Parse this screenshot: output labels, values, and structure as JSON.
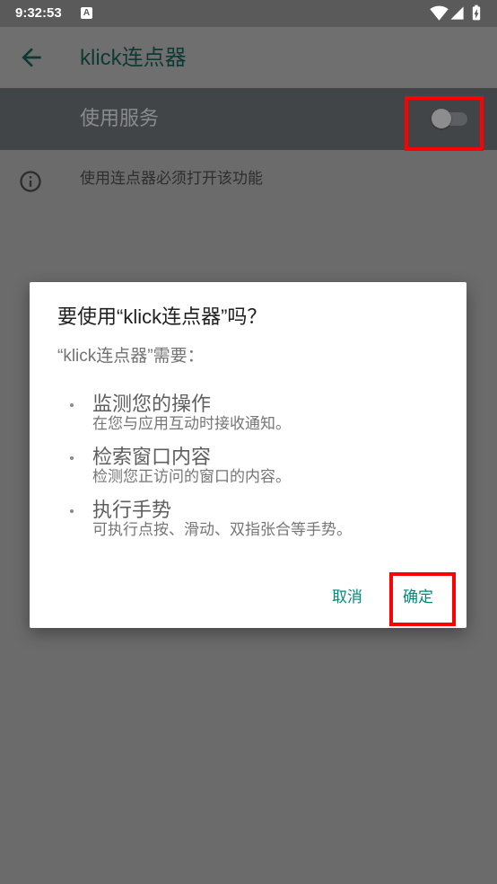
{
  "colors": {
    "accent": "#00897b",
    "highlight": "#ff0000"
  },
  "status_bar": {
    "time": "9:32:53",
    "notification_icon": "app-notification-icon",
    "notification_letter": "A",
    "wifi_icon": "wifi-icon",
    "signal_icon": "cell-signal-icon",
    "battery_icon": "battery-charging-icon"
  },
  "app_bar": {
    "back_icon": "arrow-back-icon",
    "title": "klick连点器"
  },
  "service_row": {
    "label": "使用服务",
    "toggle_checked": false
  },
  "info_row": {
    "icon": "info-icon",
    "text": "使用连点器必须打开该功能"
  },
  "dialog": {
    "title": "要使用“klick连点器”吗？",
    "subtitle": "“klick连点器”需要：",
    "permissions": [
      {
        "title": "监测您的操作",
        "description": "在您与应用互动时接收通知。"
      },
      {
        "title": "检索窗口内容",
        "description": "检测您正访问的窗口的内容。"
      },
      {
        "title": "执行手势",
        "description": "可执行点按、滑动、双指张合等手势。"
      }
    ],
    "cancel_label": "取消",
    "confirm_label": "确定"
  }
}
